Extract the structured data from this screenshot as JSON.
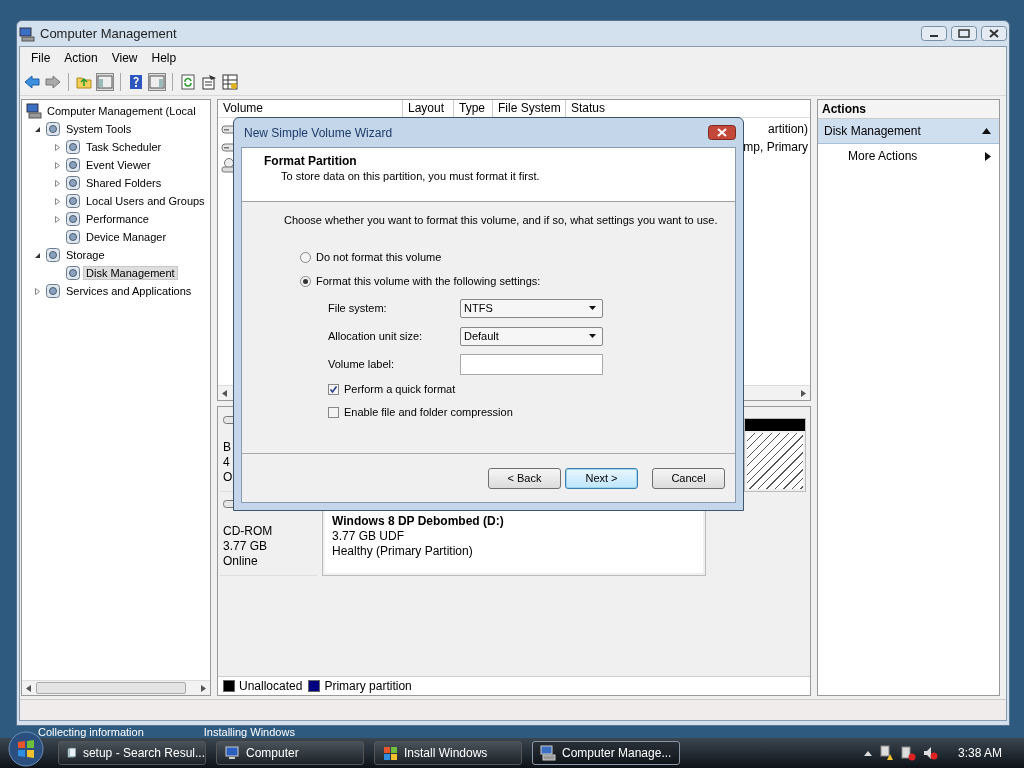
{
  "window": {
    "title": "Computer Management"
  },
  "menu": [
    "File",
    "Action",
    "View",
    "Help"
  ],
  "tree": [
    {
      "label": "Computer Management (Local",
      "selected": false,
      "children": [
        {
          "label": "System Tools",
          "expanded": true,
          "selected": false,
          "children": [
            {
              "label": "Task Scheduler",
              "expanded": false,
              "selected": false
            },
            {
              "label": "Event Viewer",
              "expanded": false,
              "selected": false
            },
            {
              "label": "Shared Folders",
              "expanded": false,
              "selected": false
            },
            {
              "label": "Local Users and Groups",
              "expanded": false,
              "selected": false
            },
            {
              "label": "Performance",
              "expanded": false,
              "selected": false
            },
            {
              "label": "Device Manager",
              "selected": false
            }
          ]
        },
        {
          "label": "Storage",
          "expanded": true,
          "selected": false,
          "children": [
            {
              "label": "Disk Management",
              "selected": true
            }
          ]
        },
        {
          "label": "Services and Applications",
          "expanded": false,
          "selected": false
        }
      ]
    }
  ],
  "volume_list": {
    "columns": [
      "Volume",
      "Layout",
      "Type",
      "File System",
      "Status"
    ],
    "rows": [
      {
        "kind": "volume",
        "status": "artition)"
      },
      {
        "kind": "volume",
        "status": "mp, Primary"
      },
      {
        "kind": "cd"
      }
    ]
  },
  "disks": [
    {
      "lines": [
        "B",
        "4",
        "O"
      ],
      "partitions": [
        {
          "kind": "unallocated"
        }
      ]
    },
    {
      "lines": [
        "CD-ROM",
        "3.77 GB",
        "Online"
      ],
      "partitions": [
        {
          "kind": "primary",
          "name": "Windows 8 DP Debombed  (D:)",
          "size": "3.77 GB UDF",
          "status": "Healthy (Primary Partition)"
        }
      ]
    }
  ],
  "legend": [
    {
      "label": "Unallocated",
      "color": "#000000"
    },
    {
      "label": "Primary partition",
      "color": "#000080"
    }
  ],
  "actions": {
    "title": "Actions",
    "items": [
      {
        "kind": "header",
        "label": "Disk Management",
        "expanded": true
      },
      {
        "kind": "submenu",
        "label": "More Actions"
      }
    ]
  },
  "dialog": {
    "title": "New Simple Volume Wizard",
    "heading": "Format Partition",
    "subheading": "To store data on this partition, you must format it first.",
    "prompt": "Choose whether you want to format this volume, and if so, what settings you want to use.",
    "options": [
      {
        "label": "Do not format this volume",
        "selected": false
      },
      {
        "label": "Format this volume with the following settings:",
        "selected": true
      }
    ],
    "fields": [
      {
        "kind": "dropdown",
        "label": "File system:",
        "value": "NTFS"
      },
      {
        "kind": "dropdown",
        "label": "Allocation unit size:",
        "value": "Default"
      },
      {
        "kind": "text",
        "label": "Volume label:"
      }
    ],
    "checkboxes": [
      {
        "label": "Perform a quick format",
        "checked": true
      },
      {
        "label": "Enable file and folder compression",
        "checked": false
      }
    ],
    "buttons": [
      {
        "label": "< Back",
        "default": false
      },
      {
        "label": "Next >",
        "default": true
      },
      {
        "label": "Cancel",
        "default": false
      }
    ]
  },
  "behind_text": [
    "Collecting information",
    "Installing Windows"
  ],
  "taskbar": {
    "buttons": [
      {
        "label": "setup - Search Resul...",
        "selected": false
      },
      {
        "label": "Computer",
        "selected": false
      },
      {
        "label": "Install Windows",
        "selected": false
      },
      {
        "label": "Computer Manage...",
        "selected": true
      }
    ],
    "clock": "3:38 AM"
  }
}
